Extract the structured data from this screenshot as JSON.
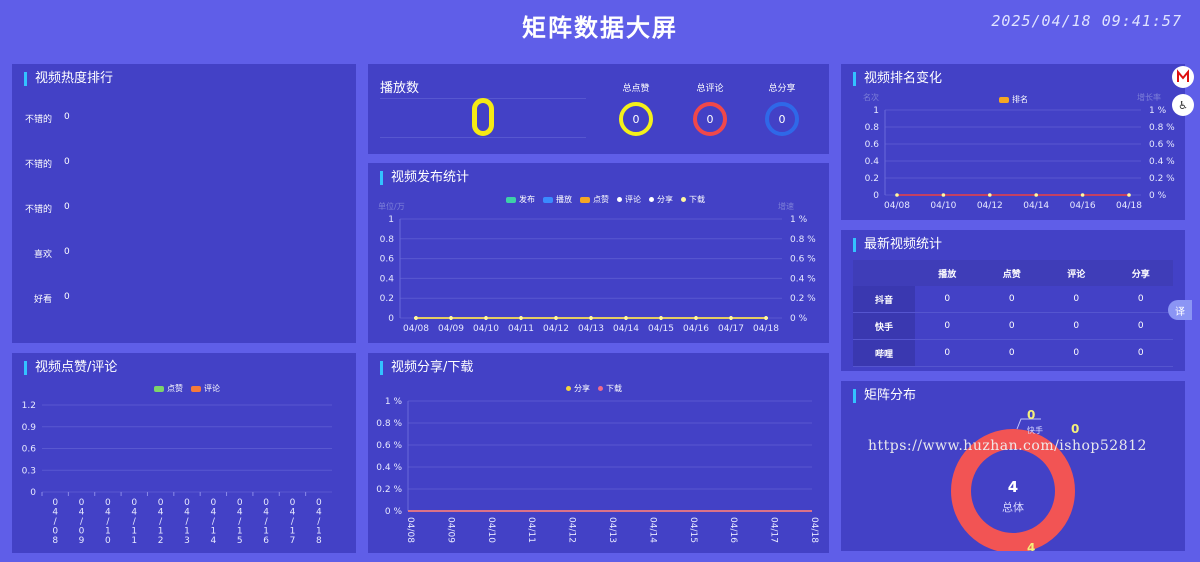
{
  "header": {
    "title": "矩阵数据大屏",
    "clock": "2025/04/18 09:41:57"
  },
  "hot_rank": {
    "title": "视频热度排行",
    "items": [
      {
        "label": "不错的",
        "value": "0"
      },
      {
        "label": "不错的",
        "value": "0"
      },
      {
        "label": "不错的",
        "value": "0"
      },
      {
        "label": "喜欢",
        "value": "0"
      },
      {
        "label": "好看",
        "value": "0"
      }
    ]
  },
  "plays": {
    "title": "播放数",
    "stats": [
      {
        "label": "总点赞",
        "value": "0",
        "color": "#f4f01a"
      },
      {
        "label": "总评论",
        "value": "0",
        "color": "#f0484a"
      },
      {
        "label": "总分享",
        "value": "0",
        "color": "#2f68e8"
      }
    ]
  },
  "release": {
    "title": "视频发布统计",
    "legend": [
      {
        "name": "发布",
        "color": "#3ed0a8",
        "shape": "rect"
      },
      {
        "name": "播放",
        "color": "#3a8bff",
        "shape": "rect"
      },
      {
        "name": "点赞",
        "color": "#f5a623",
        "shape": "rect"
      },
      {
        "name": "评论",
        "color": "#ffffff",
        "shape": "dot"
      },
      {
        "name": "分享",
        "color": "#ffffff",
        "shape": "dot"
      },
      {
        "name": "下载",
        "color": "#fff7a0",
        "shape": "dot"
      }
    ],
    "left_unit": "单位/万",
    "right_unit": "增速"
  },
  "rank_change": {
    "title": "视频排名变化",
    "legend": [
      {
        "name": "排名",
        "color": "#f5a623",
        "shape": "rect"
      }
    ],
    "left_unit": "名次",
    "right_unit": "增长率"
  },
  "latest": {
    "title": "最新视频统计",
    "headers": [
      "",
      "播放",
      "点赞",
      "评论",
      "分享"
    ],
    "rows": [
      [
        "抖音",
        "0",
        "0",
        "0",
        "0"
      ],
      [
        "快手",
        "0",
        "0",
        "0",
        "0"
      ],
      [
        "哔哩",
        "0",
        "0",
        "0",
        "0"
      ]
    ]
  },
  "likes": {
    "title": "视频点赞/评论",
    "legend": [
      {
        "name": "点赞",
        "color": "#7ed36a",
        "shape": "rect"
      },
      {
        "name": "评论",
        "color": "#f57a3a",
        "shape": "rect"
      }
    ]
  },
  "share": {
    "title": "视频分享/下载",
    "legend": [
      {
        "name": "分享",
        "color": "#f5d33a",
        "shape": "dot"
      },
      {
        "name": "下载",
        "color": "#f06a8a",
        "shape": "dot"
      }
    ]
  },
  "matrix": {
    "title": "矩阵分布",
    "total_value": "4",
    "total_label": "总体",
    "labels": [
      {
        "name": "快手",
        "value": "0"
      },
      {
        "name": "",
        "value": "0"
      },
      {
        "name": "",
        "value": "4"
      }
    ]
  },
  "watermark": "https://www.huzhan.com/ishop52812",
  "sidebar": {
    "translate_label": "译"
  },
  "chart_data": [
    {
      "type": "line",
      "title": "视频发布统计",
      "x": [
        "04/08",
        "04/09",
        "04/10",
        "04/11",
        "04/12",
        "04/13",
        "04/14",
        "04/15",
        "04/16",
        "04/17",
        "04/18"
      ],
      "y_left_ticks": [
        "0",
        "0.2",
        "0.4",
        "0.6",
        "0.8",
        "1"
      ],
      "y_right_ticks": [
        "0 %",
        "0.2 %",
        "0.4 %",
        "0.6 %",
        "0.8 %",
        "1 %"
      ],
      "ylim": [
        0,
        1
      ],
      "series": [
        {
          "name": "发布",
          "values": [
            0,
            0,
            0,
            0,
            0,
            0,
            0,
            0,
            0,
            0,
            0
          ]
        },
        {
          "name": "播放",
          "values": [
            0,
            0,
            0,
            0,
            0,
            0,
            0,
            0,
            0,
            0,
            0
          ]
        },
        {
          "name": "点赞",
          "values": [
            0,
            0,
            0,
            0,
            0,
            0,
            0,
            0,
            0,
            0,
            0
          ]
        },
        {
          "name": "评论",
          "values": [
            0,
            0,
            0,
            0,
            0,
            0,
            0,
            0,
            0,
            0,
            0
          ]
        },
        {
          "name": "分享",
          "values": [
            0,
            0,
            0,
            0,
            0,
            0,
            0,
            0,
            0,
            0,
            0
          ]
        },
        {
          "name": "下载",
          "values": [
            0,
            0,
            0,
            0,
            0,
            0,
            0,
            0,
            0,
            0,
            0
          ]
        }
      ]
    },
    {
      "type": "line",
      "title": "视频排名变化",
      "x": [
        "04/08",
        "04/10",
        "04/12",
        "04/14",
        "04/16",
        "04/18"
      ],
      "y_left_ticks": [
        "0",
        "0.2",
        "0.4",
        "0.6",
        "0.8",
        "1"
      ],
      "y_right_ticks": [
        "0 %",
        "0.2 %",
        "0.4 %",
        "0.6 %",
        "0.8 %",
        "1 %"
      ],
      "ylim": [
        0,
        1
      ],
      "series": [
        {
          "name": "排名",
          "values": [
            0,
            0,
            0,
            0,
            0,
            0
          ]
        }
      ]
    },
    {
      "type": "bar",
      "title": "视频点赞/评论",
      "categories": [
        "04/08",
        "04/09",
        "04/10",
        "04/11",
        "04/12",
        "04/13",
        "04/14",
        "04/15",
        "04/16",
        "04/17",
        "04/18"
      ],
      "y_ticks": [
        "0",
        "0.3",
        "0.6",
        "0.9",
        "1.2"
      ],
      "ylim": [
        0,
        1.2
      ],
      "series": [
        {
          "name": "点赞",
          "values": [
            0,
            0,
            0,
            0,
            0,
            0,
            0,
            0,
            0,
            0,
            0
          ]
        },
        {
          "name": "评论",
          "values": [
            0,
            0,
            0,
            0,
            0,
            0,
            0,
            0,
            0,
            0,
            0
          ]
        }
      ]
    },
    {
      "type": "line",
      "title": "视频分享/下载",
      "x": [
        "04/08",
        "04/09",
        "04/10",
        "04/11",
        "04/12",
        "04/13",
        "04/14",
        "04/15",
        "04/16",
        "04/17",
        "04/18"
      ],
      "y_ticks": [
        "0 %",
        "0.2 %",
        "0.4 %",
        "0.6 %",
        "0.8 %",
        "1 %"
      ],
      "ylim": [
        0,
        1
      ],
      "series": [
        {
          "name": "分享",
          "values": [
            0,
            0,
            0,
            0,
            0,
            0,
            0,
            0,
            0,
            0,
            0
          ]
        },
        {
          "name": "下载",
          "values": [
            0,
            0,
            0,
            0,
            0,
            0,
            0,
            0,
            0,
            0,
            0
          ]
        }
      ]
    },
    {
      "type": "pie",
      "title": "矩阵分布",
      "series": [
        {
          "name": "总体",
          "values": [
            4
          ]
        }
      ]
    }
  ]
}
